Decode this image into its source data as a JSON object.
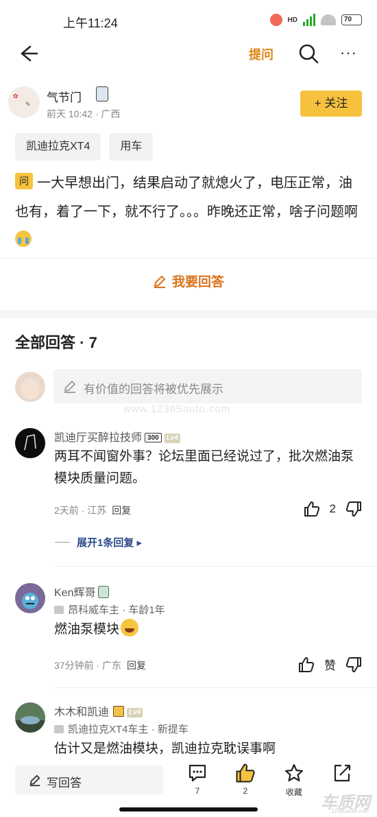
{
  "status": {
    "time": "上午11:24",
    "hd": "HD",
    "battery": "70",
    "battery_level": 0.7
  },
  "nav": {
    "ask_label": "提问",
    "more_label": "···"
  },
  "author": {
    "name": "气节门",
    "meta": "前天 10:42 · 广西",
    "follow_label": "+ 关注"
  },
  "tags": [
    "凯迪拉克XT4",
    "用车"
  ],
  "question": {
    "badge": "问",
    "text": "一大早想出门，结果启动了就熄火了，电压正常，油也有，着了一下，就不行了。。。昨晚还正常，啥子问题啊"
  },
  "answer_button_label": "我要回答",
  "all_answers": {
    "label": "全部回答",
    "separator": "·",
    "count": "7"
  },
  "comment_input": {
    "placeholder": "有价值的回答将被优先展示"
  },
  "watermark": "www.12365auto.com",
  "replies": [
    {
      "name": "凯迪厅买醉拉技师",
      "level_badge": "300",
      "lv": "Lv4",
      "body": "两耳不闻窗外事？论坛里面已经说过了，批次燃油泵模块质量问题。",
      "time_loc": "2天前 · 江苏",
      "reply_label": "回复",
      "like_count": "2",
      "expand_label": "展开1条回复 ▸"
    },
    {
      "name": "Ken辉哥",
      "sub": "昂科威车主 · 车龄1年",
      "body": "燃油泵模块",
      "time_loc": "37分钟前 · 广东",
      "reply_label": "回复",
      "like_label": "赞"
    },
    {
      "name": "木木和凯迪",
      "lv": "Lv4",
      "sub": "凯迪拉克XT4车主 · 新提车",
      "body": "估计又是燃油模块，凯迪拉克耽误事啊"
    }
  ],
  "bottom_bar": {
    "write_label": "写回答",
    "comments_count": "7",
    "likes_count": "2",
    "favorite_label": "收藏"
  },
  "logo": {
    "name": "车质网",
    "url": "12365auto.com"
  }
}
